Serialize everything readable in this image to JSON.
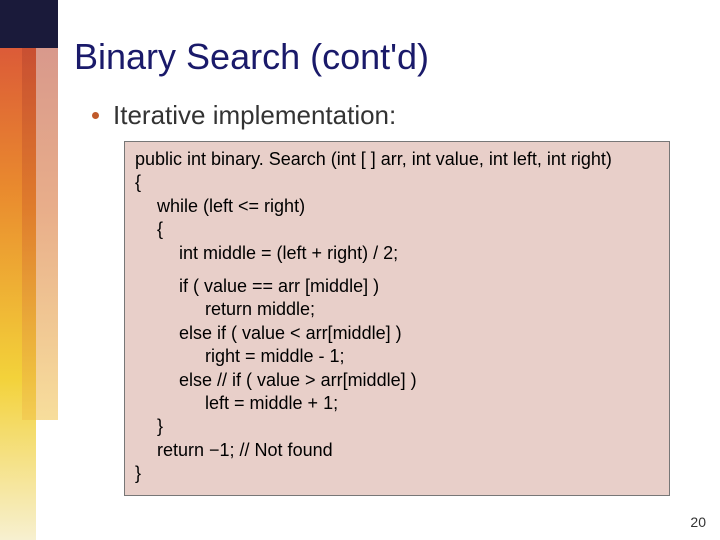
{
  "slide": {
    "title": "Binary Search (cont'd)",
    "bullet": "Iterative implementation:",
    "page_number": "20"
  },
  "code": {
    "l01": "public int binary. Search (int [ ] arr, int value, int left, int right)",
    "l02": "{",
    "l03": "while (left <= right)",
    "l04": "{",
    "l05": "int middle = (left + right) / 2;",
    "l06": "if ( value == arr [middle] )",
    "l07": "return middle;",
    "l08": "else if ( value < arr[middle] )",
    "l09": "right = middle - 1;",
    "l10": "else    //  if ( value > arr[middle] )",
    "l11": "left = middle + 1;",
    "l12": "}",
    "l13": "return −1;  // Not found",
    "l14": "}"
  }
}
